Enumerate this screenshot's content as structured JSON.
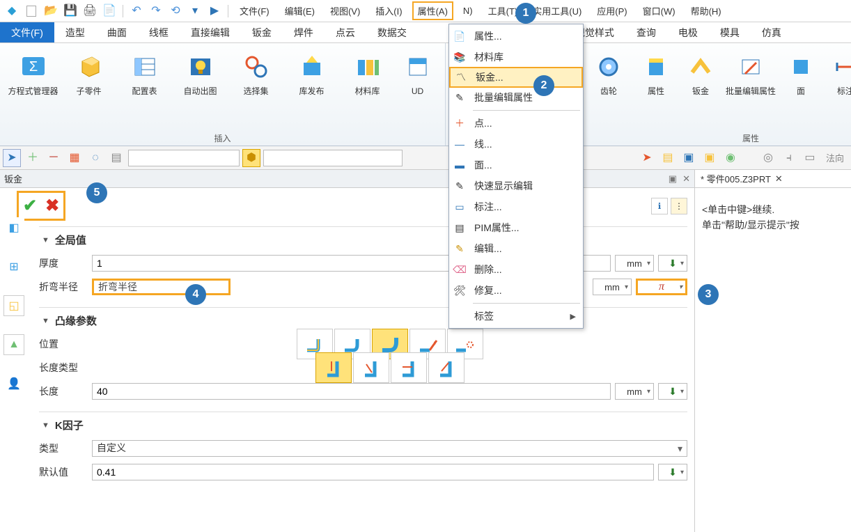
{
  "menubar": {
    "items": [
      "文件(F)",
      "编辑(E)",
      "视图(V)",
      "插入(I)",
      "属性(A)",
      "N)",
      "工具(T)",
      "实用工具(U)",
      "应用(P)",
      "窗口(W)",
      "帮助(H)"
    ],
    "highlight_index": 4
  },
  "ribbon_tabs": [
    "文件(F)",
    "造型",
    "曲面",
    "线框",
    "直接编辑",
    "钣金",
    "焊件",
    "点云",
    "数据交",
    "",
    "视觉样式",
    "查询",
    "电极",
    "模具",
    "仿真"
  ],
  "ribbon_active_index": 0,
  "ribbon": {
    "group1_title": "插入",
    "group1": [
      {
        "label": "方程式管理器"
      },
      {
        "label": "子零件"
      },
      {
        "label": "配置表"
      },
      {
        "label": "自动出图"
      },
      {
        "label": "选择集"
      },
      {
        "label": "库发布"
      },
      {
        "label": "材料库"
      },
      {
        "label": "UD"
      }
    ],
    "group2_title": "",
    "group2": [
      {
        "label": "齿轮"
      }
    ],
    "group3_title": "属性",
    "group3": [
      {
        "label": "属性"
      },
      {
        "label": "钣金"
      },
      {
        "label": "批量编辑属性"
      },
      {
        "label": "面"
      },
      {
        "label": "标注"
      }
    ]
  },
  "toolbar2": {
    "combo_value": "",
    "right_label": "法向"
  },
  "panel": {
    "title": "钣金",
    "section_global": "全局值",
    "thickness_label": "厚度",
    "thickness_value": "1",
    "thickness_unit": "mm",
    "bend_label": "折弯半径",
    "bend_value": "折弯半径",
    "bend_unit": "mm",
    "bend_menu": "π",
    "section_flange": "凸缘参数",
    "pos_label": "位置",
    "len_type_label": "长度类型",
    "length_label": "长度",
    "length_value": "40",
    "length_unit": "mm",
    "section_k": "K因子",
    "type_label": "类型",
    "type_value": "自定义",
    "default_label": "默认值",
    "default_value": "0.41"
  },
  "attr_menu": {
    "items": [
      {
        "label": "属性..."
      },
      {
        "label": "材料库"
      },
      {
        "label": "钣金...",
        "hl": true
      },
      {
        "label": "批量编辑属性",
        "sep_after": true
      },
      {
        "label": "点..."
      },
      {
        "label": "线..."
      },
      {
        "label": "面..."
      },
      {
        "label": "快速显示编辑"
      },
      {
        "label": "标注..."
      },
      {
        "label": "PIM属性..."
      },
      {
        "label": "编辑..."
      },
      {
        "label": "删除..."
      },
      {
        "label": "修复...",
        "sep_after": true
      },
      {
        "label": "标签",
        "arrow": true
      }
    ]
  },
  "right_panel": {
    "tab_title": "* 零件005.Z3PRT",
    "hint1": "<单击中键>继续.",
    "hint2": "单击\"帮助/显示提示\"按"
  },
  "badges": {
    "1": "1",
    "2": "2",
    "3": "3",
    "4": "4",
    "5": "5"
  }
}
